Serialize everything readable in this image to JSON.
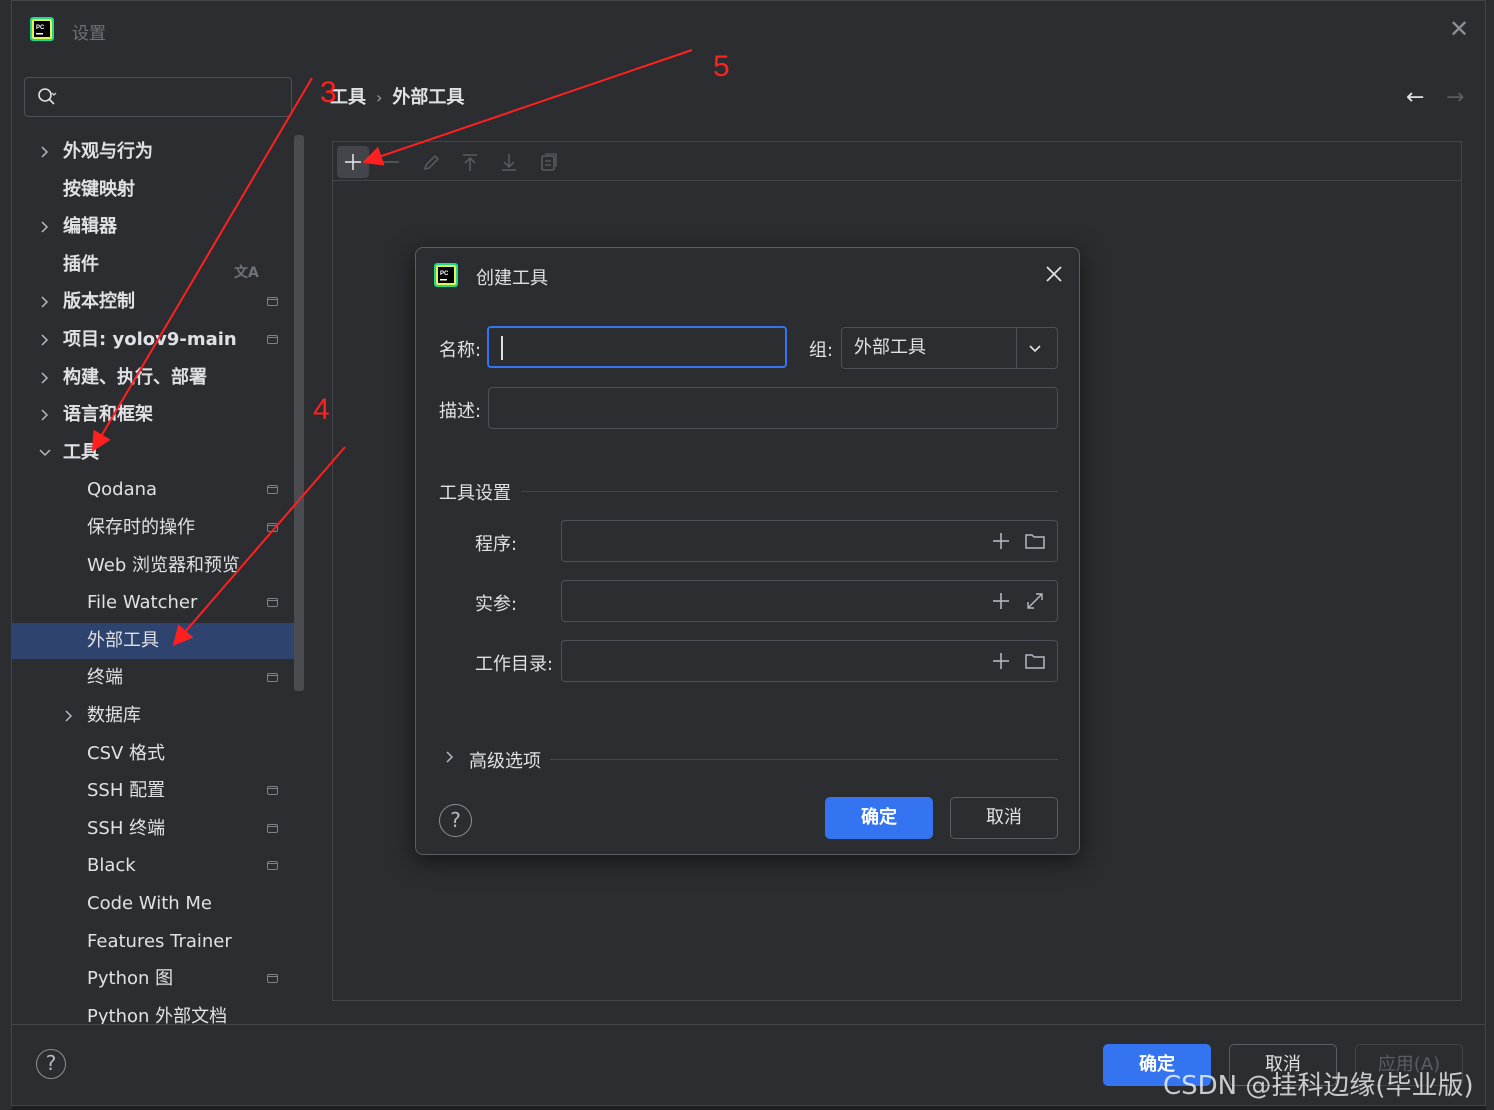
{
  "window": {
    "title": "设置",
    "close_icon": "close-icon"
  },
  "search": {
    "placeholder": ""
  },
  "tree": [
    {
      "label": "外观与行为",
      "bold": true,
      "expandable": true,
      "expanded": false
    },
    {
      "label": "按键映射",
      "bold": true,
      "expandable": false
    },
    {
      "label": "编辑器",
      "bold": true,
      "expandable": true,
      "expanded": false
    },
    {
      "label": "插件",
      "bold": true,
      "expandable": false,
      "icon": "translate-icon"
    },
    {
      "label": "版本控制",
      "bold": true,
      "expandable": true,
      "expanded": false,
      "badge": true
    },
    {
      "label": "项目: yolov9-main",
      "bold": true,
      "expandable": true,
      "expanded": false,
      "badge": true
    },
    {
      "label": "构建、执行、部署",
      "bold": true,
      "expandable": true,
      "expanded": false
    },
    {
      "label": "语言和框架",
      "bold": true,
      "expandable": true,
      "expanded": false
    },
    {
      "label": "工具",
      "bold": true,
      "expandable": true,
      "expanded": true
    },
    {
      "label": "Qodana",
      "level": 1,
      "badge": true
    },
    {
      "label": "保存时的操作",
      "level": 1,
      "badge": true
    },
    {
      "label": "Web 浏览器和预览",
      "level": 1
    },
    {
      "label": "File Watcher",
      "level": 1,
      "badge": true
    },
    {
      "label": "外部工具",
      "level": 1,
      "selected": true
    },
    {
      "label": "终端",
      "level": 1,
      "badge": true
    },
    {
      "label": "数据库",
      "level": 1,
      "expandable": true,
      "expanded": false
    },
    {
      "label": "CSV 格式",
      "level": 1
    },
    {
      "label": "SSH 配置",
      "level": 1,
      "badge": true
    },
    {
      "label": "SSH 终端",
      "level": 1,
      "badge": true
    },
    {
      "label": "Black",
      "level": 1,
      "badge": true
    },
    {
      "label": "Code With Me",
      "level": 1
    },
    {
      "label": "Features Trainer",
      "level": 1
    },
    {
      "label": "Python 图",
      "level": 1,
      "badge": true
    },
    {
      "label": "Python 外部文档",
      "level": 1
    }
  ],
  "breadcrumb": {
    "parent": "工具",
    "separator": "›",
    "current": "外部工具"
  },
  "toolbar": {
    "buttons": [
      "plus-icon",
      "minus-icon",
      "edit-icon",
      "move-up-icon",
      "move-down-icon",
      "copy-icon"
    ]
  },
  "annotations": [
    {
      "number": "3"
    },
    {
      "number": "4"
    },
    {
      "number": "5"
    }
  ],
  "dialog": {
    "title": "创建工具",
    "name_label": "名称:",
    "name_value": "",
    "group_label": "组:",
    "group_value": "外部工具",
    "description_label": "描述:",
    "description_value": "",
    "section_title": "工具设置",
    "program_label": "程序:",
    "args_label": "实参:",
    "workdir_label": "工作目录:",
    "advanced_label": "高级选项",
    "ok_label": "确定",
    "cancel_label": "取消",
    "help": "?"
  },
  "footer": {
    "help": "?",
    "ok_label": "确定",
    "cancel_label": "取消",
    "apply_label": "应用(A)"
  },
  "watermark": "CSDN @挂科边缘(毕业版)",
  "colors": {
    "accent": "#3574f0",
    "selection": "#2e436e",
    "annotation": "#ff2020",
    "background": "#2b2d30"
  }
}
